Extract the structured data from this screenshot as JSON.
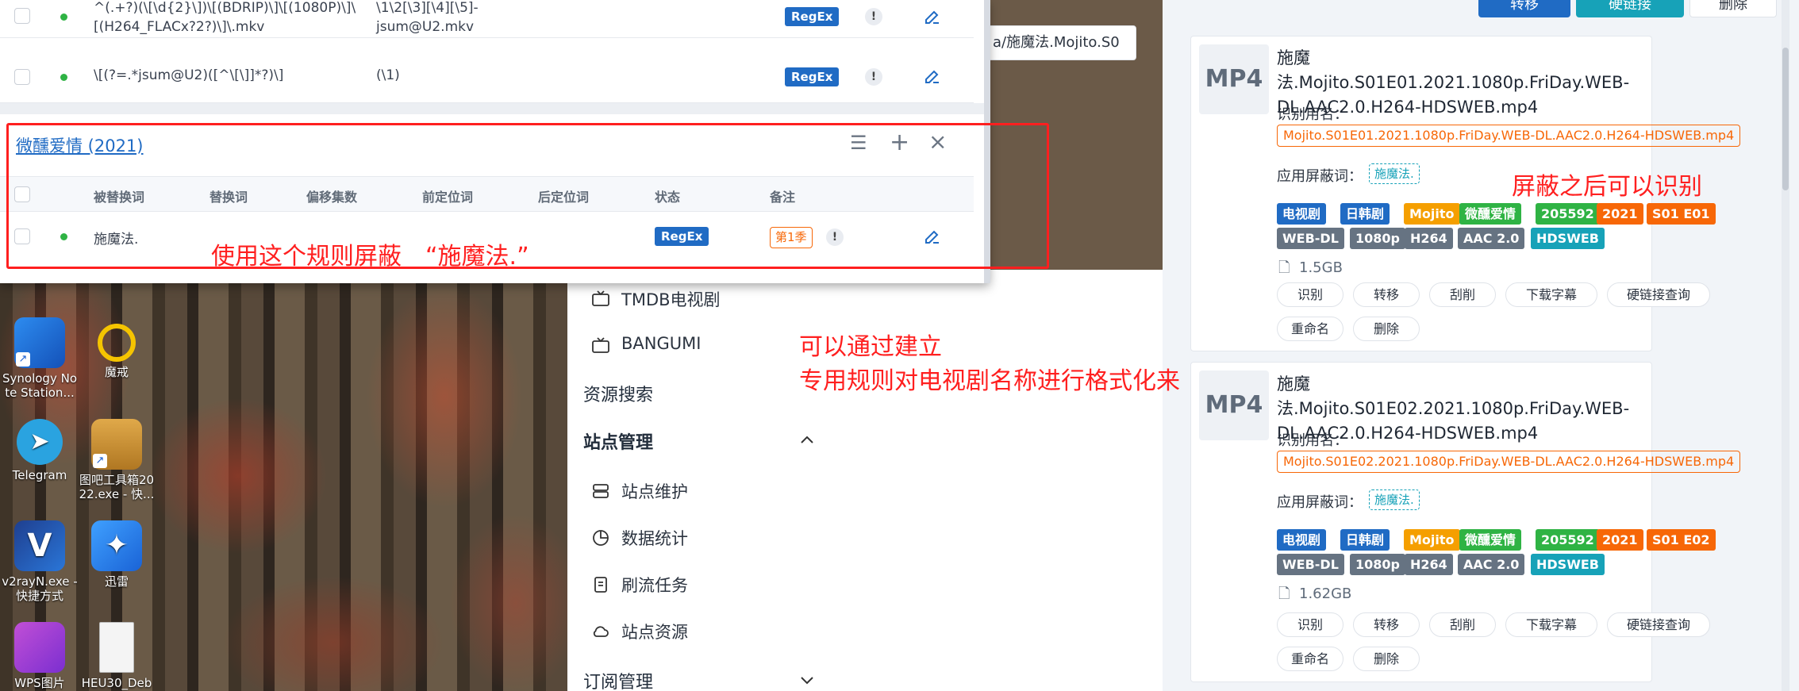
{
  "rules_top": [
    {
      "pattern_l1": "^(.+?)(\\[\\d{2}\\])\\[(BDRIP)\\]\\[(1080P)\\]\\",
      "pattern_l2": "[(H264_FLACx?2?)\\]\\.mkv",
      "replace_l1": "\\1\\2[\\3][\\4][\\5]-",
      "replace_l2": "jsum@U2.mkv",
      "badge": "RegEx"
    },
    {
      "pattern_l1": "\\[(?=.*jsum@U2)([^\\[\\]]*?)\\]",
      "pattern_l2": "",
      "replace_l1": "(\\1)",
      "replace_l2": "",
      "badge": "RegEx"
    }
  ],
  "group": {
    "title": "微醺爱情 (2021)",
    "headers": [
      "被替换词",
      "替换词",
      "偏移集数",
      "前定位词",
      "后定位词",
      "状态",
      "备注"
    ],
    "row": {
      "word": "施魔法.",
      "badge": "RegEx",
      "note": "第1季"
    }
  },
  "path_fragment": "a/施魔法.Mojito.S0",
  "sidebar": {
    "items": [
      {
        "label": "TMDB电视剧",
        "icon": "tv-icon"
      },
      {
        "label": "BANGUMI",
        "icon": "tv-icon"
      },
      {
        "label": "资源搜索"
      },
      {
        "label": "站点管理"
      },
      {
        "label": "站点维护",
        "icon": "server-icon"
      },
      {
        "label": "数据统计",
        "icon": "pie-chart-icon"
      },
      {
        "label": "刷流任务",
        "icon": "clipboard-icon"
      },
      {
        "label": "站点资源",
        "icon": "cloud-icon"
      },
      {
        "label": "订阅管理"
      }
    ]
  },
  "desktop_icons": [
    {
      "label_l1": "Synology No",
      "label_l2": "te Station..."
    },
    {
      "label_l1": "魔戒",
      "label_l2": ""
    },
    {
      "label_l1": "Telegram",
      "label_l2": ""
    },
    {
      "label_l1": "图吧工具箱20",
      "label_l2": "22.exe - 快..."
    },
    {
      "label_l1": "v2rayN.exe -",
      "label_l2": "快捷方式"
    },
    {
      "label_l1": "迅雷",
      "label_l2": ""
    },
    {
      "label_l1": "WPS图片",
      "label_l2": ""
    },
    {
      "label_l1": "HEU30_Deb",
      "label_l2": ""
    }
  ],
  "top_buttons": {
    "transfer": "转移",
    "hardlink": "硬链接",
    "delete": "删除"
  },
  "files": [
    {
      "type": "MP4",
      "title": "施魔法.Mojito.S01E01.2021.1080p.FriDay.WEB-DL.AAC2.0.H264-HDSWEB.mp4",
      "recog_label": "识别用名：",
      "recog_name": "Mojito.S01E01.2021.1080p.FriDay.WEB-DL.AAC2.0.H264-HDSWEB.mp4",
      "shield_label": "应用屏蔽词：",
      "shield_word": "施魔法.",
      "tags_row1": [
        "电视剧",
        "日韩剧",
        "Mojito",
        "微醺爱情",
        "205592",
        "2021",
        "S01 E01"
      ],
      "tags_row2": [
        "WEB-DL",
        "1080p",
        "H264",
        "AAC 2.0",
        "HDSWEB"
      ],
      "size": "1.5GB",
      "actions_row1": [
        "识别",
        "转移",
        "刮削",
        "下载字幕",
        "硬链接查询"
      ],
      "actions_row2": [
        "重命名",
        "删除"
      ]
    },
    {
      "type": "MP4",
      "title": "施魔法.Mojito.S01E02.2021.1080p.FriDay.WEB-DL.AAC2.0.H264-HDSWEB.mp4",
      "recog_label": "识别用名：",
      "recog_name": "Mojito.S01E02.2021.1080p.FriDay.WEB-DL.AAC2.0.H264-HDSWEB.mp4",
      "shield_label": "应用屏蔽词：",
      "shield_word": "施魔法.",
      "tags_row1": [
        "电视剧",
        "日韩剧",
        "Mojito",
        "微醺爱情",
        "205592",
        "2021",
        "S01 E02"
      ],
      "tags_row2": [
        "WEB-DL",
        "1080p",
        "H264",
        "AAC 2.0",
        "HDSWEB"
      ],
      "size": "1.62GB",
      "actions_row1": [
        "识别",
        "转移",
        "刮削",
        "下载字幕",
        "硬链接查询"
      ],
      "actions_row2": [
        "重命名",
        "删除"
      ]
    }
  ],
  "annotations": {
    "rule_note": "使用这个规则屏蔽　“施魔法.”",
    "recognized_note": "屏蔽之后可以识别",
    "format_note_l1": "可以通过建立",
    "format_note_l2": "专用规则对电视剧名称进行格式化来"
  },
  "colors": {
    "regex_blue": "#206bc4",
    "status_green": "#2fb344",
    "annotation_red": "#ff1f1f",
    "tag_blue": "#206bc4",
    "tag_yellow": "#f59f00",
    "tag_green": "#2fb344",
    "tag_orange": "#f76707",
    "tag_gray": "#667382",
    "tag_cyan": "#17a2b8",
    "btn_teal": "#17a2b8"
  }
}
